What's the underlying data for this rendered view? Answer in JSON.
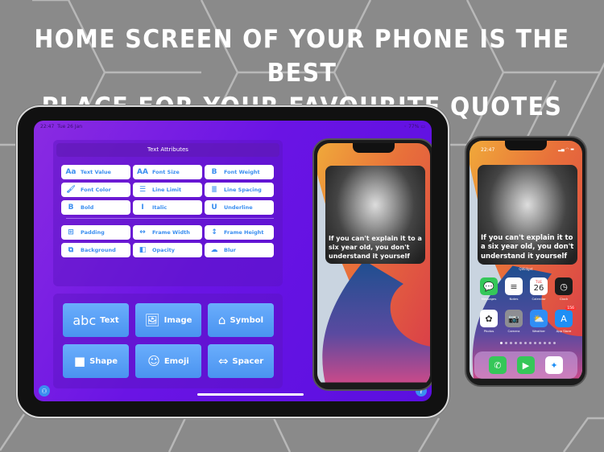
{
  "headline": {
    "line1": "HOME SCREEN OF YOUR PHONE IS THE BEST",
    "line2": "PLACE FOR YOUR FAVOURITE QUOTES"
  },
  "ipad": {
    "status": {
      "time": "22:47",
      "date": "Tue 26 Jan",
      "battery": "77%"
    },
    "text_attributes": {
      "title": "Text Attributes",
      "group1": [
        {
          "label": "Text Value",
          "icon": "text-value-icon",
          "glyph": "Aa"
        },
        {
          "label": "Font Size",
          "icon": "font-size-icon",
          "glyph": "AA"
        },
        {
          "label": "Font Weight",
          "icon": "font-weight-icon",
          "glyph": "B"
        },
        {
          "label": "Font Color",
          "icon": "paintbrush-icon",
          "glyph": "🖌"
        },
        {
          "label": "Line Limit",
          "icon": "line-limit-icon",
          "glyph": "☰"
        },
        {
          "label": "Line Spacing",
          "icon": "line-spacing-icon",
          "glyph": "≣"
        },
        {
          "label": "Bold",
          "icon": "bold-icon",
          "glyph": "B"
        },
        {
          "label": "Italic",
          "icon": "italic-icon",
          "glyph": "I"
        },
        {
          "label": "Underline",
          "icon": "underline-icon",
          "glyph": "U"
        }
      ],
      "group2": [
        {
          "label": "Padding",
          "icon": "padding-icon",
          "glyph": "⊞"
        },
        {
          "label": "Frame Width",
          "icon": "frame-width-icon",
          "glyph": "↔"
        },
        {
          "label": "Frame Height",
          "icon": "frame-height-icon",
          "glyph": "↕"
        },
        {
          "label": "Background",
          "icon": "background-icon",
          "glyph": "⧉"
        },
        {
          "label": "Opacity",
          "icon": "opacity-icon",
          "glyph": "◧"
        },
        {
          "label": "Blur",
          "icon": "blur-icon",
          "glyph": "☁"
        }
      ]
    },
    "add_elements": [
      {
        "label": "Text",
        "icon": "abc-icon",
        "glyph": "abc"
      },
      {
        "label": "Image",
        "icon": "image-icon",
        "glyph": "🖼"
      },
      {
        "label": "Symbol",
        "icon": "house-icon",
        "glyph": "⌂"
      },
      {
        "label": "Shape",
        "icon": "square-icon",
        "glyph": "■"
      },
      {
        "label": "Emoji",
        "icon": "smiley-icon",
        "glyph": "☺"
      },
      {
        "label": "Spacer",
        "icon": "spacer-icon",
        "glyph": "⇔"
      }
    ],
    "help_glyph": "?"
  },
  "quote": {
    "text": "If you can't explain it to a six year old, you don't understand it yourself"
  },
  "iphone": {
    "status_time": "22:47",
    "widget_label": "QWidget",
    "apps": [
      {
        "label": "Messages",
        "icon": "messages-icon",
        "glyph": "💬",
        "color": "#35c759"
      },
      {
        "label": "Notes",
        "icon": "notes-icon",
        "glyph": "≡",
        "color": "#fdfdfd"
      },
      {
        "label": "Calendar",
        "icon": "calendar-icon",
        "glyph": "26",
        "day": "TUE",
        "color": "#ffffff"
      },
      {
        "label": "Clock",
        "icon": "clock-icon",
        "glyph": "◷",
        "color": "#1c1c1c"
      },
      {
        "label": "Photos",
        "icon": "photos-icon",
        "glyph": "✿",
        "color": "#ffffff"
      },
      {
        "label": "Camera",
        "icon": "camera-icon",
        "glyph": "📷",
        "color": "#8e8e93"
      },
      {
        "label": "Weather",
        "icon": "weather-icon",
        "glyph": "⛅",
        "color": "#2f8ef5"
      },
      {
        "label": "App Store",
        "icon": "app-store-icon",
        "glyph": "A",
        "color": "#1e8ff5",
        "badge": "156"
      }
    ],
    "dock": [
      {
        "name": "phone-app-icon",
        "glyph": "✆",
        "color": "#35c759"
      },
      {
        "name": "facetime-app-icon",
        "glyph": "▶",
        "color": "#35c759"
      },
      {
        "name": "safari-app-icon",
        "glyph": "✦",
        "color": "#ffffff"
      }
    ],
    "page_count": 12,
    "current_page": 1
  }
}
